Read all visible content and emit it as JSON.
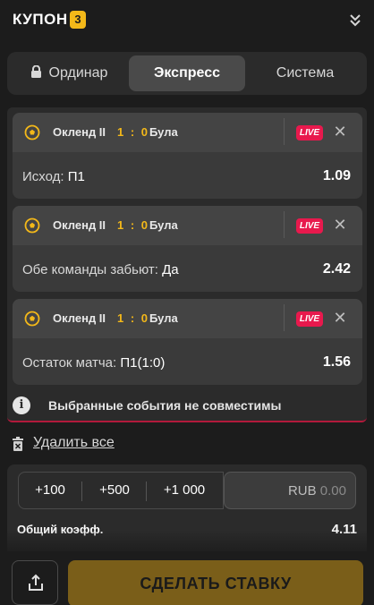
{
  "header": {
    "title": "КУПОН",
    "count": "3",
    "collapse_icon": "chevron-double-down-icon"
  },
  "tabs": [
    {
      "label": "Ординар",
      "icon": "lock-icon",
      "active": false
    },
    {
      "label": "Экспресс",
      "active": true
    },
    {
      "label": "Система",
      "active": false
    }
  ],
  "bets": [
    {
      "team1": "Окленд II",
      "score": "1 : 0",
      "team2": "Була",
      "live": "LIVE",
      "market": "Исход:",
      "pick": "П1",
      "odd": "1.09"
    },
    {
      "team1": "Окленд II",
      "score": "1 : 0",
      "team2": "Була",
      "live": "LIVE",
      "market": "Обе команды забьют:",
      "pick": "Да",
      "odd": "2.42"
    },
    {
      "team1": "Окленд II",
      "score": "1 : 0",
      "team2": "Була",
      "live": "LIVE",
      "market": "Остаток матча:",
      "pick": "П1(1:0)",
      "odd": "1.56"
    }
  ],
  "warning": {
    "text": "Выбранные события не совместимы",
    "icon": "info-icon"
  },
  "delete_all": "Удалить все",
  "stake": {
    "quick": [
      "+100",
      "+500",
      "+1 000"
    ],
    "currency": "RUB",
    "amount": "0.00",
    "total_label": "Общий коэфф.",
    "total_value": "4.11"
  },
  "footer": {
    "cta": "СДЕЛАТЬ СТАВКУ",
    "share_icon": "share-icon"
  },
  "colors": {
    "accent": "#f3b819",
    "live": "#e8194d",
    "cta": "#7a5e19",
    "background": "#1c1c1c"
  }
}
